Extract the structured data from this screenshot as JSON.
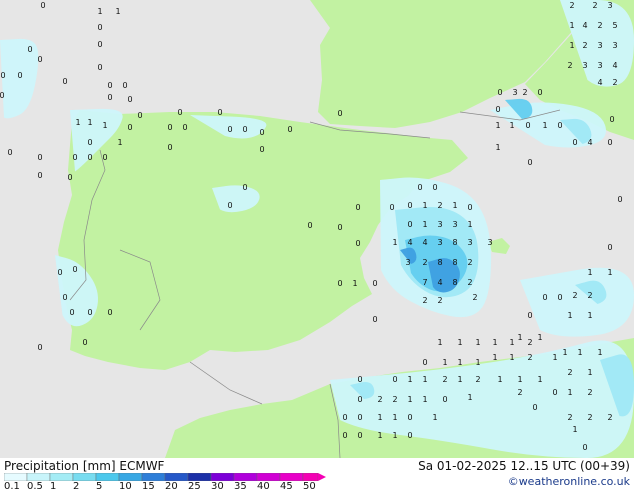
{
  "footer": {
    "legend_title": "Precipitation [mm]  ECMWF",
    "datetime": "Sa 01-02-2025 12..15 UTC (00+39)",
    "credit": "©weatheronline.co.uk"
  },
  "legend": {
    "ticks": [
      "0.1",
      "0.5",
      "1",
      "2",
      "5",
      "10",
      "15",
      "20",
      "25",
      "30",
      "35",
      "40",
      "45",
      "50"
    ],
    "colors": [
      "#e6fbff",
      "#c8f4fa",
      "#a4ecf5",
      "#78dcf0",
      "#4cc8ec",
      "#38a8e4",
      "#2e7ed8",
      "#2558c8",
      "#1c30a8",
      "#7c00d8",
      "#b000dc",
      "#d000d4",
      "#e800c8",
      "#f400b4"
    ]
  },
  "map": {
    "sea_color": "#e6e6e6",
    "land_color": "#c2f2a2",
    "precip_light": "#cdf6fb",
    "precip_medium": "#9fe8f6",
    "precip_strong": "#63cdef",
    "precip_heavy": "#3e9fe0",
    "values": [
      "0",
      "1",
      "2",
      "3",
      "4",
      "5",
      "6",
      "7",
      "8"
    ]
  }
}
